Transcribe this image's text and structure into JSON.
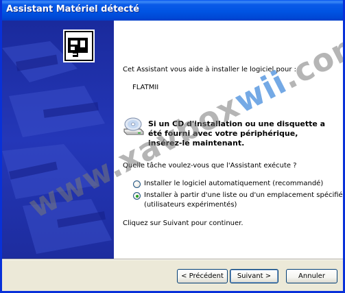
{
  "window": {
    "title": "Assistant Matériel détecté"
  },
  "main": {
    "intro": "Cet Assistant vous aide à installer le logiciel pour :",
    "device_name": "FLATMII",
    "cd_prompt": "Si un CD d'installation ou une disquette a été fourni avec votre périphérique, insérez-le maintenant.",
    "question": "Quelle tâche voulez-vous que l'Assistant exécute ?",
    "options": [
      {
        "label": "Installer le logiciel automatiquement (recommandé)",
        "selected": false
      },
      {
        "label_line1": "Installer à partir d'une liste ou d'un emplacement spécifié",
        "label_line2": "(utilisateurs expérimentés)",
        "selected": true
      }
    ],
    "instruction": "Cliquez sur Suivant pour continuer."
  },
  "buttons": {
    "back": "< Précédent",
    "next": "Suivant >",
    "cancel": "Annuler"
  },
  "watermark": {
    "part1": "www.xavbox",
    "part2": "wii",
    "part3": ".com"
  },
  "icons": {
    "hardware": "hardware-board-icon",
    "cd": "cd-drive-icon"
  },
  "colors": {
    "title_bar": "#0054e3",
    "side_panel": "#2437b8",
    "window_border": "#0831d9",
    "face": "#ece9d8"
  }
}
